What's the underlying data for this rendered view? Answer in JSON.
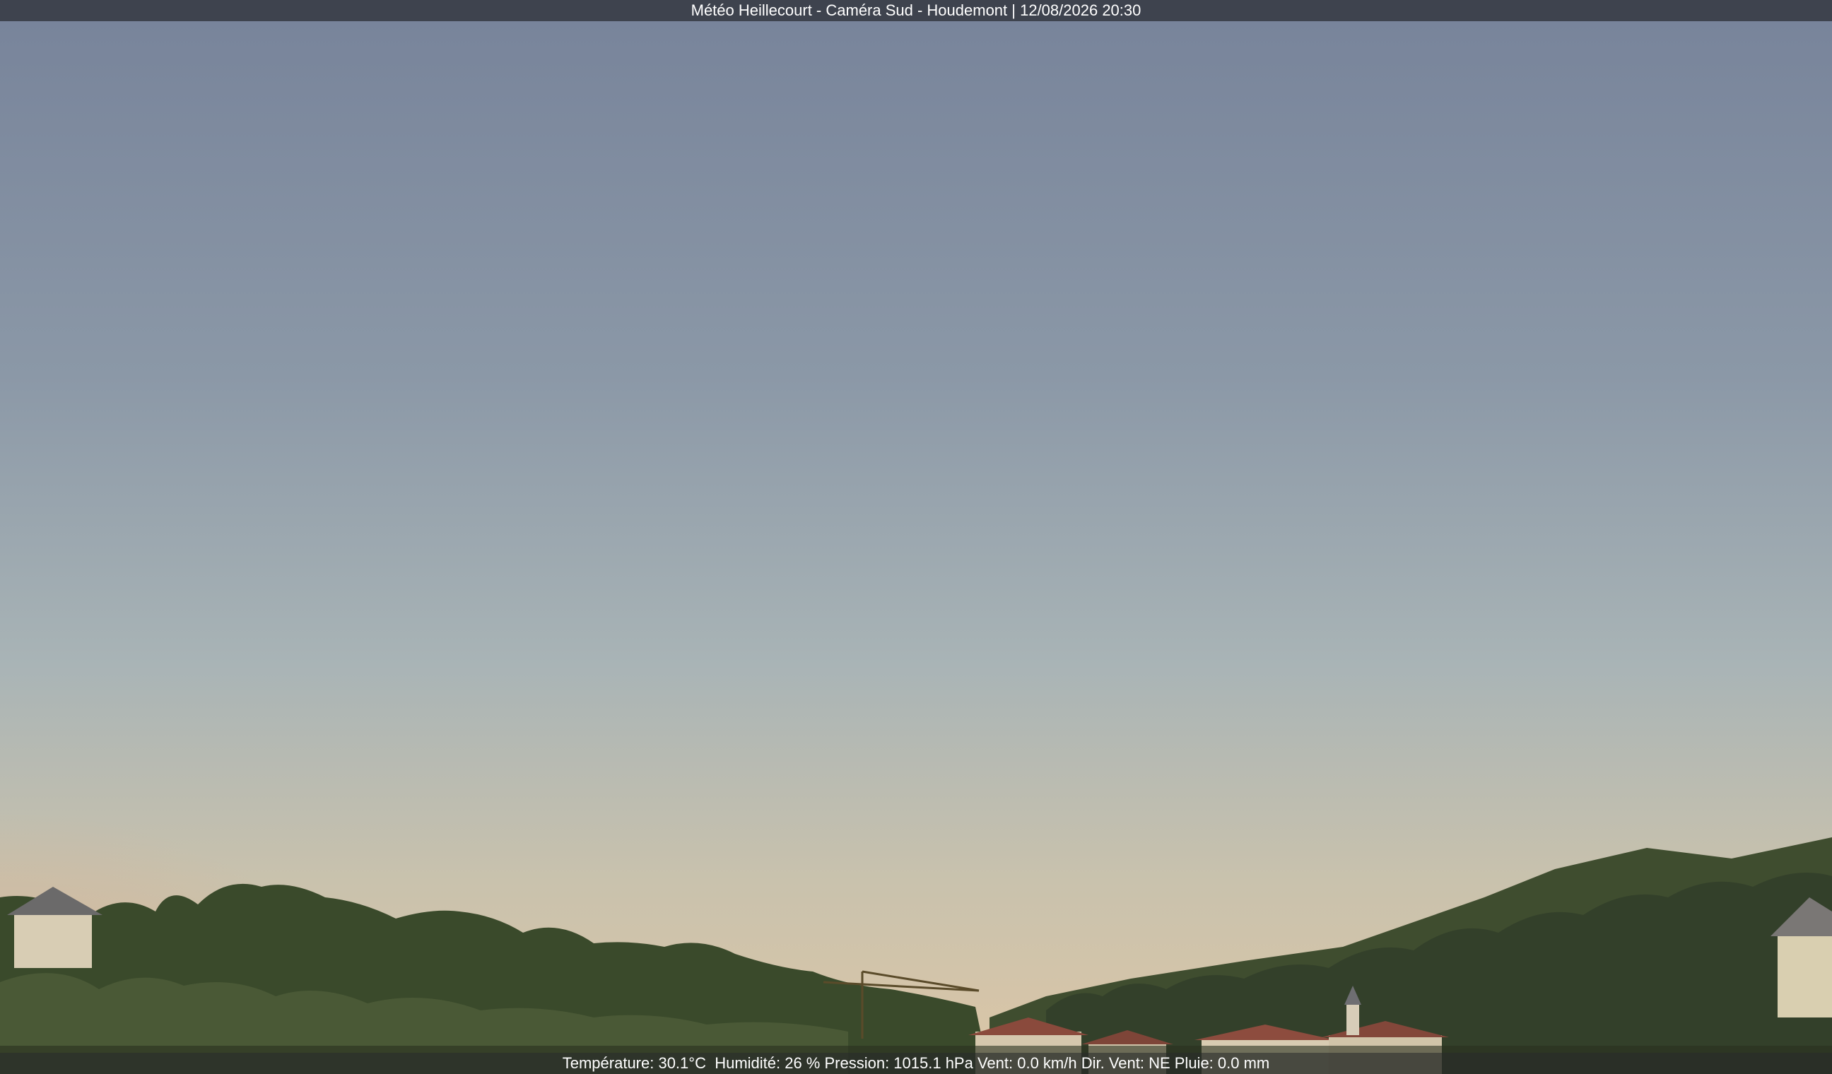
{
  "overlay": {
    "title": "Météo Heillecourt - Caméra Sud - Houdemont | 12/08/2026 20:30",
    "weather": "Température: 30.1°C  Humidité: 26 % Pression: 1015.1 hPa Vent: 0.0 km/h Dir. Vent: NE Pluie: 0.0 mm"
  },
  "colors": {
    "sky_top": "#78849a",
    "sky_mid": "#9aa7b1",
    "sky_horizon": "#d6c3a7",
    "sky_glow": "#d9b596",
    "trees_dark": "#2f3a25",
    "trees_light": "#4d5d36",
    "roof": "#8a4a3c",
    "wall": "#d8cdb4"
  }
}
